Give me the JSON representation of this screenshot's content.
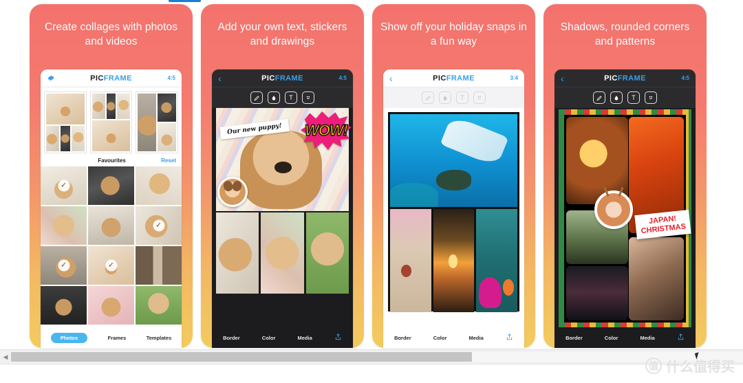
{
  "page": {
    "background": "#ffffff",
    "accent_blue": "#3aa0e8",
    "card_gradient_top": "#f4726d",
    "card_gradient_bottom": "#f3cb5e"
  },
  "top_indicator": {
    "color": "#1a7fd4"
  },
  "cards": [
    {
      "id": "card-1",
      "title": "Create collages with photos and videos",
      "phone": {
        "theme": "light",
        "navbar": {
          "left_icon": "gear-icon",
          "brand_first": "PIC",
          "brand_second": "FRAME",
          "aspect": "4:5"
        },
        "favourites_label": "Favourites",
        "reset_label": "Reset",
        "tabs": [
          {
            "label": "Photos",
            "active": true
          },
          {
            "label": "Frames",
            "active": false
          },
          {
            "label": "Templates",
            "active": false
          }
        ],
        "selected_count": 4
      }
    },
    {
      "id": "card-2",
      "title": "Add your own text, stickers and drawings",
      "phone": {
        "theme": "dark",
        "navbar": {
          "left_icon": "chevron-left-icon",
          "brand_first": "PIC",
          "brand_second": "FRAME",
          "aspect": "4:5"
        },
        "tool_icons": [
          "brush-icon",
          "droplet-icon",
          "text-icon",
          "sticker-icon"
        ],
        "stickers": {
          "handwriting": "Our new puppy!",
          "comic": "WOW!",
          "badge": "dog-sticker"
        },
        "tabs": [
          {
            "label": "Border",
            "active": false
          },
          {
            "label": "Color",
            "active": false
          },
          {
            "label": "Media",
            "active": false
          }
        ],
        "share_icon": "share-icon"
      }
    },
    {
      "id": "card-3",
      "title": "Show off your holiday snaps in a fun way",
      "phone": {
        "theme": "light",
        "navbar": {
          "left_icon": "chevron-left-icon",
          "brand_first": "PIC",
          "brand_second": "FRAME",
          "aspect": "3:4"
        },
        "tool_icons": [
          "brush-icon",
          "droplet-icon",
          "text-icon",
          "sticker-icon"
        ],
        "tabs": [
          {
            "label": "Border",
            "active": false
          },
          {
            "label": "Color",
            "active": false
          },
          {
            "label": "Media",
            "active": false
          }
        ],
        "share_icon": "share-icon"
      }
    },
    {
      "id": "card-4",
      "title": "Shadows, rounded corners and patterns",
      "phone": {
        "theme": "dark",
        "navbar": {
          "left_icon": "chevron-left-icon",
          "brand_first": "PIC",
          "brand_second": "FRAME",
          "aspect": "4:5"
        },
        "tool_icons": [
          "brush-icon",
          "droplet-icon",
          "text-icon",
          "sticker-icon"
        ],
        "stickers": {
          "label_line1": "JAPAN!",
          "label_line2": "CHRISTMAS",
          "badge": "reindeer-sticker"
        },
        "tabs": [
          {
            "label": "Border",
            "active": false
          },
          {
            "label": "Color",
            "active": false
          },
          {
            "label": "Media",
            "active": false
          }
        ],
        "share_icon": "share-icon"
      }
    }
  ],
  "scrollbar": {
    "left_arrow": "◀",
    "thumb_percent": 63
  },
  "watermark": {
    "badge": "值",
    "text": "什么值得买"
  }
}
